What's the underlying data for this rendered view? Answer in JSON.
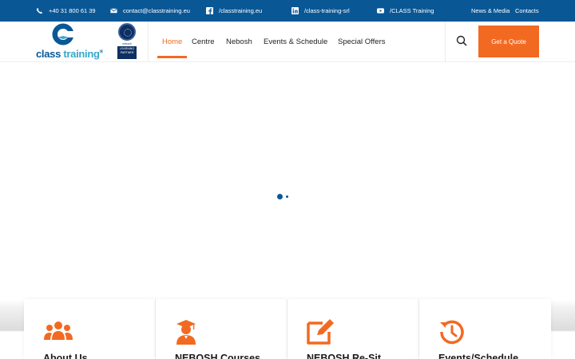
{
  "topbar": {
    "phone": "+40 31 800 61 39",
    "email": "contact@classtraining.eu",
    "facebook": "/classtraining.eu",
    "linkedin": "/class-training-srl",
    "youtube": "/CLASS Training",
    "news_media": "News & Media",
    "contacts": "Contacts"
  },
  "logo": {
    "word1": "class",
    "word2": "training",
    "reg": "®"
  },
  "badge": {
    "small": "nebosh",
    "box": "LEARNING PARTNER"
  },
  "nav": {
    "items": [
      "Home",
      "Centre",
      "Nebosh",
      "Events & Schedule",
      "Special Offers"
    ],
    "active": "Home"
  },
  "header": {
    "quote_button": "Get a Quote"
  },
  "cards": [
    {
      "title": "About Us",
      "icon": "users-icon"
    },
    {
      "title": "NEBOSH Courses",
      "icon": "graduate-icon"
    },
    {
      "title": "NEBOSH Re-Sit",
      "icon": "edit-icon"
    },
    {
      "title": "Events/Schedule",
      "icon": "history-icon"
    }
  ],
  "colors": {
    "primary": "#0a5796",
    "accent": "#f26a21",
    "logo_blue": "#36a9c9"
  }
}
